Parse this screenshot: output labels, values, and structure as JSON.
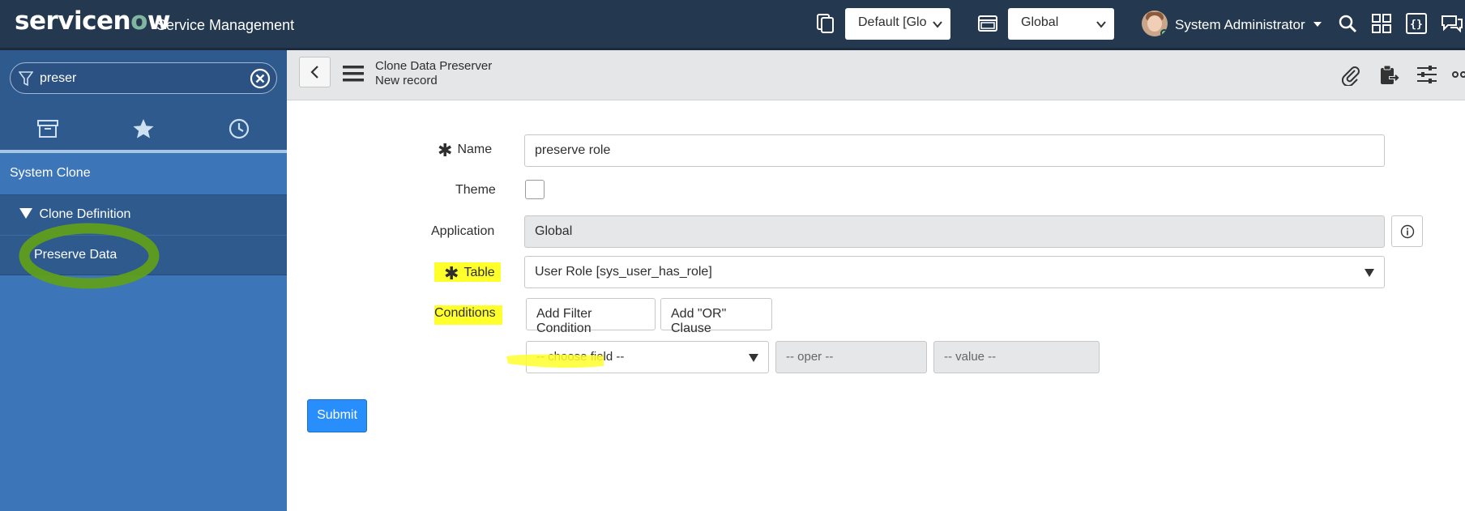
{
  "header": {
    "logo_prefix": "servicen",
    "logo_o": "o",
    "logo_suffix": "w",
    "app_title": "Service Management",
    "update_set_value": "Default [Glo",
    "application_scope_value": "Global",
    "user_name": "System Administrator",
    "icons": [
      "update-set-icon",
      "application-picker-icon",
      "search-icon",
      "connect-icon",
      "script-debugger-icon",
      "chat-icon"
    ]
  },
  "sidebar": {
    "filter_value": "preser",
    "tabs": [
      "all-apps-icon",
      "favorites-star-icon",
      "history-clock-icon"
    ],
    "application": "System Clone",
    "module": "Clone Definition",
    "item": "Preserve Data"
  },
  "form_header": {
    "title": "Clone Data Preserver",
    "subtitle": "New record",
    "icons": [
      "attachment-icon",
      "clipboard-icon",
      "personalize-form-icon",
      "more-options-icon"
    ]
  },
  "form": {
    "name_label": "Name",
    "name_value": "preserve role",
    "theme_label": "Theme",
    "application_label": "Application",
    "application_value": "Global",
    "table_label": "Table",
    "table_value": "User Role [sys_user_has_role]",
    "conditions_label": "Conditions",
    "add_filter_label": "Add Filter Condition",
    "add_or_label": "Add \"OR\" Clause",
    "choose_field": "-- choose field --",
    "oper": "-- oper --",
    "value": "-- value --",
    "submit_label": "Submit"
  },
  "colors": {
    "header_bg": "#24384f",
    "sidebar_bg": "#3c76b8",
    "sidebar_dark": "#2e5a8e",
    "submit_blue": "#278efc",
    "highlight_yellow": "#ffff2b",
    "annotation_green": "#5f9e1c"
  }
}
